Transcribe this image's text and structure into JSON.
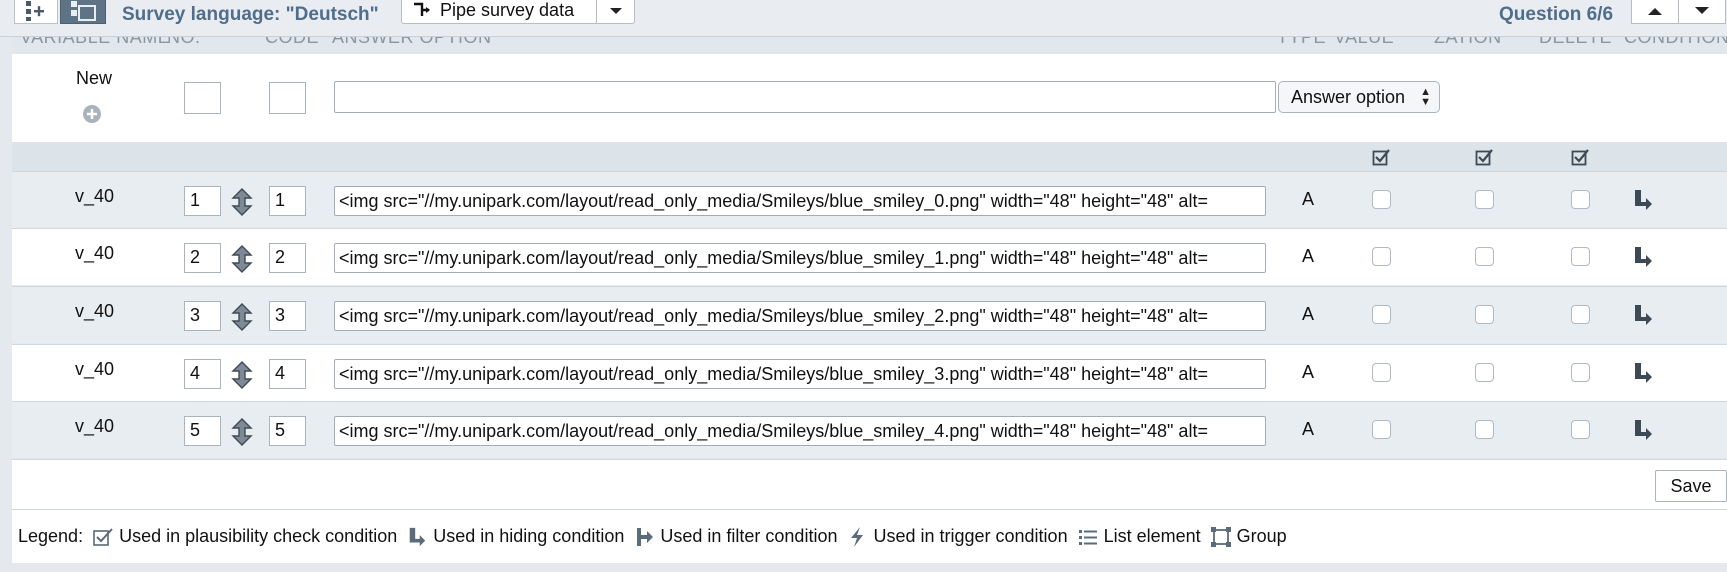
{
  "toolbar": {
    "survey_language": "Survey language: \"Deutsch\"",
    "pipe_label": "Pipe survey data",
    "question_label": "Question 6/6"
  },
  "column_headers": [
    "VARIABLE NAME",
    "NO.",
    "CODE",
    "ANSWER OPTION",
    "TYPE",
    "VALUE",
    "ZATION",
    "DELETE",
    "CONDITION"
  ],
  "new_row": {
    "label": "New",
    "select_value": "Answer option"
  },
  "rows": [
    {
      "var": "v_40",
      "no": "1",
      "code": "1",
      "text": "<img src=\"//my.unipark.com/layout/read_only_media/Smileys/blue_smiley_0.png\" width=\"48\" height=\"48\" alt=",
      "type": "A"
    },
    {
      "var": "v_40",
      "no": "2",
      "code": "2",
      "text": "<img src=\"//my.unipark.com/layout/read_only_media/Smileys/blue_smiley_1.png\" width=\"48\" height=\"48\" alt=",
      "type": "A"
    },
    {
      "var": "v_40",
      "no": "3",
      "code": "3",
      "text": "<img src=\"//my.unipark.com/layout/read_only_media/Smileys/blue_smiley_2.png\" width=\"48\" height=\"48\" alt=",
      "type": "A"
    },
    {
      "var": "v_40",
      "no": "4",
      "code": "4",
      "text": "<img src=\"//my.unipark.com/layout/read_only_media/Smileys/blue_smiley_3.png\" width=\"48\" height=\"48\" alt=",
      "type": "A"
    },
    {
      "var": "v_40",
      "no": "5",
      "code": "5",
      "text": "<img src=\"//my.unipark.com/layout/read_only_media/Smileys/blue_smiley_4.png\" width=\"48\" height=\"48\" alt=",
      "type": "A"
    }
  ],
  "save_label": "Save",
  "legend": {
    "title": "Legend:",
    "plausibility": "Used in plausibility check condition",
    "hiding": "Used in hiding condition",
    "filter": "Used in filter condition",
    "trigger": "Used in trigger condition",
    "list": "List element",
    "group": "Group"
  },
  "colors": {
    "accent_text": "#4f6d8c",
    "dark_button": "#5e7486",
    "row_shade": "#e8edf1"
  }
}
